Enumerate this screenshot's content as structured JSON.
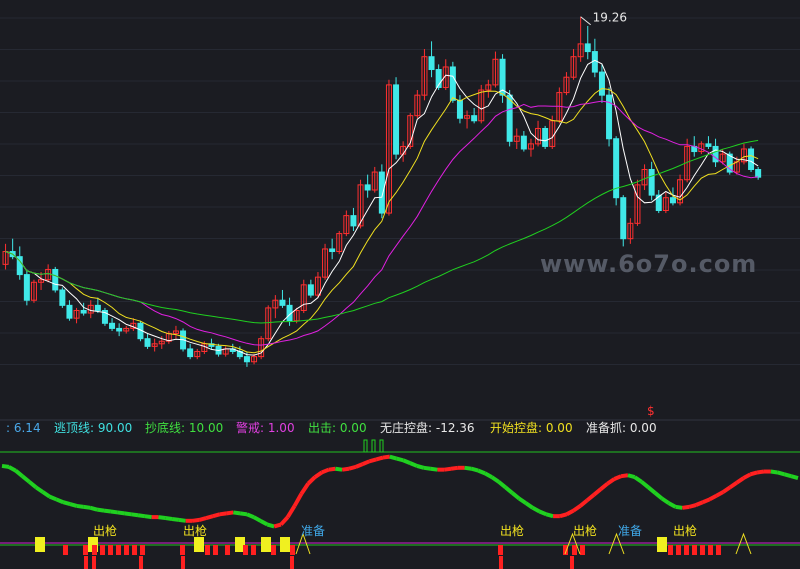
{
  "chart_data": [
    {
      "type": "candlestick",
      "title": "",
      "high_marker": "19.26",
      "watermark": "www.6o7o.com",
      "signal_marker": "$",
      "colors": {
        "up": "#ff3030",
        "down": "#40e8e8",
        "ma5": "#ffffff",
        "ma10": "#f0e020",
        "ma20": "#e020e0",
        "ma60": "#20d020"
      },
      "ohlc": [
        [
          9.6,
          10.4,
          9.4,
          10.1
        ],
        [
          10.1,
          10.6,
          9.8,
          9.9
        ],
        [
          9.9,
          10.3,
          9.0,
          9.2
        ],
        [
          9.2,
          9.4,
          8.0,
          8.2
        ],
        [
          8.2,
          9.0,
          8.1,
          8.9
        ],
        [
          8.9,
          9.3,
          8.6,
          9.0
        ],
        [
          9.0,
          9.6,
          8.9,
          9.4
        ],
        [
          9.4,
          9.5,
          8.5,
          8.6
        ],
        [
          8.6,
          8.7,
          7.9,
          8.0
        ],
        [
          8.0,
          8.2,
          7.4,
          7.5
        ],
        [
          7.5,
          7.9,
          7.3,
          7.8
        ],
        [
          7.8,
          8.1,
          7.6,
          7.7
        ],
        [
          7.7,
          8.2,
          7.5,
          8.0
        ],
        [
          8.0,
          8.3,
          7.7,
          7.8
        ],
        [
          7.8,
          7.9,
          7.2,
          7.3
        ],
        [
          7.3,
          7.5,
          7.0,
          7.1
        ],
        [
          7.1,
          7.3,
          6.8,
          7.0
        ],
        [
          7.0,
          7.2,
          6.9,
          7.1
        ],
        [
          7.1,
          7.5,
          7.0,
          7.3
        ],
        [
          7.3,
          7.4,
          6.6,
          6.7
        ],
        [
          6.7,
          6.9,
          6.3,
          6.4
        ],
        [
          6.4,
          6.7,
          6.2,
          6.5
        ],
        [
          6.5,
          6.8,
          6.3,
          6.6
        ],
        [
          6.6,
          7.0,
          6.5,
          6.9
        ],
        [
          6.9,
          7.2,
          6.7,
          7.0
        ],
        [
          7.0,
          7.1,
          6.2,
          6.3
        ],
        [
          6.3,
          6.5,
          5.9,
          6.0
        ],
        [
          6.0,
          6.3,
          5.9,
          6.2
        ],
        [
          6.2,
          6.6,
          6.1,
          6.5
        ],
        [
          6.5,
          6.7,
          6.3,
          6.4
        ],
        [
          6.4,
          6.5,
          6.0,
          6.1
        ],
        [
          6.1,
          6.4,
          6.0,
          6.3
        ],
        [
          6.3,
          6.5,
          6.1,
          6.2
        ],
        [
          6.2,
          6.4,
          5.9,
          6.0
        ],
        [
          6.0,
          6.2,
          5.6,
          5.8
        ],
        [
          5.8,
          6.1,
          5.7,
          6.0
        ],
        [
          6.0,
          6.8,
          5.9,
          6.7
        ],
        [
          6.7,
          8.0,
          6.6,
          7.9
        ],
        [
          7.9,
          8.4,
          7.5,
          8.2
        ],
        [
          8.2,
          8.6,
          7.9,
          8.0
        ],
        [
          8.0,
          8.3,
          7.2,
          7.4
        ],
        [
          7.4,
          7.9,
          7.3,
          7.8
        ],
        [
          7.8,
          9.0,
          7.7,
          8.8
        ],
        [
          8.8,
          9.0,
          8.3,
          8.4
        ],
        [
          8.4,
          9.3,
          8.3,
          9.1
        ],
        [
          9.1,
          10.4,
          9.0,
          10.2
        ],
        [
          10.2,
          10.6,
          9.8,
          10.1
        ],
        [
          10.1,
          10.9,
          10.0,
          10.8
        ],
        [
          10.8,
          11.7,
          10.7,
          11.5
        ],
        [
          11.5,
          11.8,
          10.9,
          11.1
        ],
        [
          11.1,
          12.9,
          11.0,
          12.7
        ],
        [
          12.7,
          13.1,
          12.2,
          12.5
        ],
        [
          12.5,
          13.4,
          12.4,
          13.2
        ],
        [
          13.2,
          13.5,
          11.4,
          11.6
        ],
        [
          11.6,
          16.8,
          11.5,
          16.6
        ],
        [
          16.6,
          16.9,
          13.7,
          13.9
        ],
        [
          13.9,
          14.4,
          13.6,
          14.2
        ],
        [
          14.2,
          15.5,
          14.1,
          15.4
        ],
        [
          15.4,
          16.4,
          15.3,
          16.2
        ],
        [
          16.2,
          18.0,
          16.0,
          17.7
        ],
        [
          17.7,
          18.3,
          16.9,
          17.2
        ],
        [
          17.2,
          17.4,
          16.4,
          16.5
        ],
        [
          16.5,
          17.6,
          16.4,
          17.3
        ],
        [
          17.3,
          17.5,
          15.9,
          16.0
        ],
        [
          16.0,
          16.2,
          15.1,
          15.3
        ],
        [
          15.3,
          15.6,
          14.9,
          15.4
        ],
        [
          15.4,
          15.7,
          15.1,
          15.2
        ],
        [
          15.2,
          16.6,
          15.1,
          16.4
        ],
        [
          16.4,
          16.8,
          16.1,
          16.6
        ],
        [
          16.6,
          17.9,
          16.5,
          17.6
        ],
        [
          17.6,
          17.8,
          15.9,
          16.2
        ],
        [
          16.2,
          16.4,
          14.2,
          14.4
        ],
        [
          14.4,
          14.9,
          14.1,
          14.6
        ],
        [
          14.6,
          14.8,
          14.0,
          14.1
        ],
        [
          14.1,
          14.5,
          13.8,
          14.3
        ],
        [
          14.3,
          15.2,
          14.2,
          14.9
        ],
        [
          14.9,
          15.0,
          14.1,
          14.2
        ],
        [
          14.2,
          15.4,
          14.1,
          15.2
        ],
        [
          15.2,
          16.5,
          15.1,
          16.3
        ],
        [
          16.3,
          17.1,
          16.2,
          16.9
        ],
        [
          16.9,
          18.0,
          16.8,
          17.7
        ],
        [
          17.7,
          19.26,
          17.5,
          18.2
        ],
        [
          18.2,
          18.9,
          17.6,
          17.9
        ],
        [
          17.9,
          18.4,
          16.9,
          17.1
        ],
        [
          17.1,
          17.4,
          15.9,
          16.2
        ],
        [
          16.2,
          16.5,
          14.2,
          14.5
        ],
        [
          14.5,
          14.6,
          11.9,
          12.2
        ],
        [
          12.2,
          12.3,
          10.3,
          10.6
        ],
        [
          10.6,
          11.4,
          10.4,
          11.2
        ],
        [
          11.2,
          12.9,
          11.1,
          12.7
        ],
        [
          12.7,
          13.5,
          12.5,
          13.3
        ],
        [
          13.3,
          13.6,
          12.1,
          12.3
        ],
        [
          12.3,
          12.5,
          11.6,
          11.7
        ],
        [
          11.7,
          12.4,
          11.6,
          12.2
        ],
        [
          12.2,
          12.6,
          11.9,
          12.0
        ],
        [
          12.0,
          13.1,
          11.9,
          12.9
        ],
        [
          12.9,
          14.5,
          12.8,
          14.2
        ],
        [
          14.2,
          14.6,
          13.8,
          14.0
        ],
        [
          14.0,
          14.4,
          13.9,
          14.3
        ],
        [
          14.3,
          14.6,
          14.1,
          14.2
        ],
        [
          14.2,
          14.5,
          13.4,
          13.6
        ],
        [
          13.6,
          14.1,
          13.5,
          13.9
        ],
        [
          13.9,
          14.0,
          13.1,
          13.2
        ],
        [
          13.2,
          13.8,
          13.1,
          13.6
        ],
        [
          13.6,
          14.3,
          13.5,
          14.1
        ],
        [
          14.1,
          14.2,
          13.2,
          13.3
        ],
        [
          13.3,
          13.4,
          12.9,
          13.0
        ]
      ]
    },
    {
      "type": "indicator",
      "values_row": [
        {
          "label": "",
          "value": "6.14",
          "color": "#4aa8e8"
        },
        {
          "label": "逃顶线",
          "value": "90.00",
          "color": "#40e0e0"
        },
        {
          "label": "抄底线",
          "value": "10.00",
          "color": "#40e040"
        },
        {
          "label": "警戒",
          "value": "1.00",
          "color": "#e040e0"
        },
        {
          "label": "出击",
          "value": "0.00",
          "color": "#40e040"
        },
        {
          "label": "无庄控盘",
          "value": "-12.36",
          "color": "#e8e8e8"
        },
        {
          "label": "开始控盘",
          "value": "0.00",
          "color": "#f0e020"
        },
        {
          "label": "准备抓",
          "value": "0.00",
          "color": "#e8e8e8"
        }
      ],
      "signals": [
        {
          "text": "出枪",
          "color": "#f0e020"
        },
        {
          "text": "出枪",
          "color": "#f0e020"
        },
        {
          "text": "准备",
          "color": "#40a8e8"
        },
        {
          "text": "出枪",
          "color": "#f0e020"
        },
        {
          "text": "出枪",
          "color": "#f0e020"
        },
        {
          "text": "准备",
          "color": "#40a8e8"
        },
        {
          "text": "出枪",
          "color": "#f0e020"
        }
      ],
      "osc": [
        85,
        84,
        80,
        74,
        68,
        62,
        57,
        52,
        49,
        46,
        44,
        42,
        41,
        40,
        38,
        37,
        36,
        35,
        34,
        33,
        32,
        31,
        30,
        30,
        29,
        28,
        27,
        26,
        26,
        27,
        29,
        31,
        33,
        34,
        35,
        34,
        33,
        30,
        26,
        22,
        20,
        22,
        30,
        42,
        55,
        66,
        73,
        78,
        81,
        82,
        81,
        82,
        84,
        87,
        90,
        92,
        94,
        95,
        93,
        91,
        88,
        85,
        83,
        82,
        81,
        81,
        82,
        83,
        83,
        82,
        80,
        77,
        73,
        68,
        62,
        56,
        50,
        45,
        40,
        36,
        33,
        31,
        31,
        33,
        37,
        42,
        48,
        54,
        60,
        66,
        71,
        74,
        75,
        73,
        68,
        62,
        56,
        50,
        45,
        41,
        40,
        41,
        43,
        46,
        49,
        53,
        57,
        62,
        67,
        72,
        76,
        78,
        79,
        79,
        78,
        76,
        74,
        72
      ]
    }
  ]
}
